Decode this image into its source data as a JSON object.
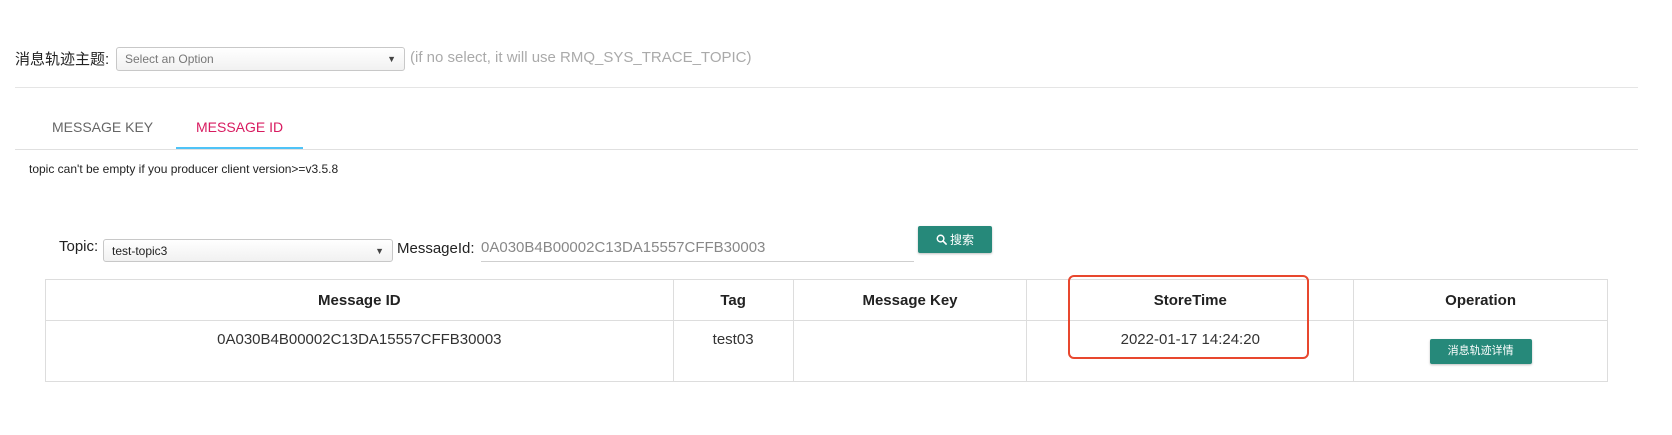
{
  "trace": {
    "label": "消息轨迹主题:",
    "select_placeholder": "Select an Option",
    "hint": "(if no select, it will use RMQ_SYS_TRACE_TOPIC)"
  },
  "tabs": [
    {
      "label": "MESSAGE KEY",
      "active": false
    },
    {
      "label": "MESSAGE ID",
      "active": true
    }
  ],
  "notice": "topic can't be empty if you producer client version>=v3.5.8",
  "query": {
    "topic_label": "Topic:",
    "topic_value": "test-topic3",
    "msgid_label": "MessageId:",
    "msgid_value": "0A030B4B00002C13DA15557CFFB30003",
    "search_label": "搜索",
    "search_icon": "search-icon"
  },
  "table": {
    "columns": [
      "Message ID",
      "Tag",
      "Message Key",
      "StoreTime",
      "Operation"
    ],
    "rows": [
      {
        "message_id": "0A030B4B00002C13DA15557CFFB30003",
        "tag": "test03",
        "message_key": "",
        "store_time": "2022-01-17 14:24:20",
        "operation_label": "消息轨迹详情"
      }
    ]
  },
  "colors": {
    "accent": "#26897a",
    "active_tab": "#d81b60",
    "tab_indicator": "#4fc3f7",
    "highlight": "#e8472e"
  }
}
